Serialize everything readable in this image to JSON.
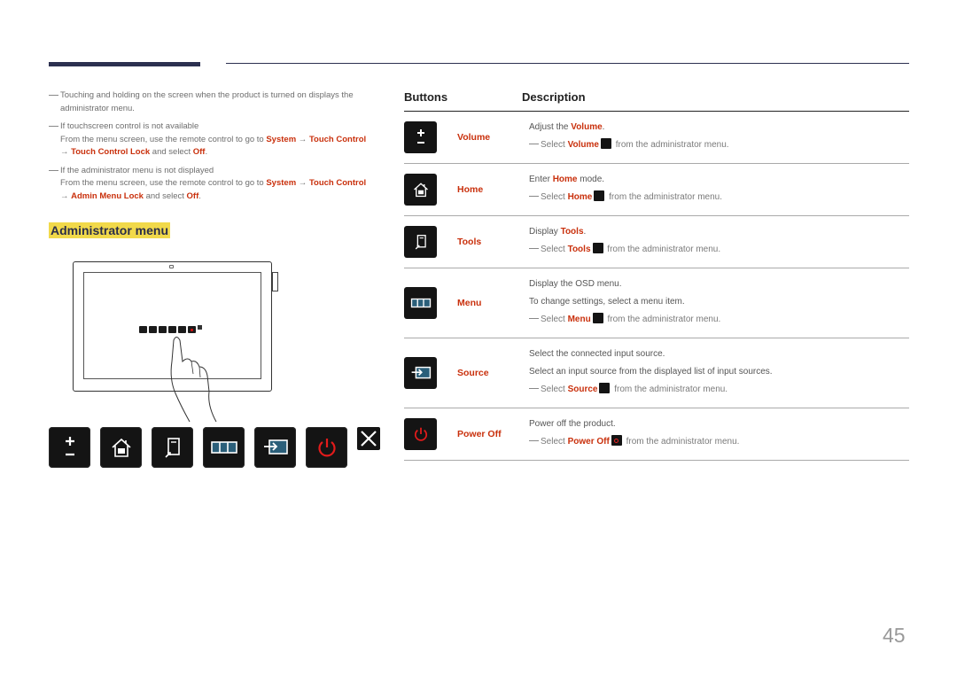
{
  "notes": [
    {
      "text": "Touching and holding on the screen when the product is turned on displays the administrator menu."
    },
    {
      "text": "If touchscreen control is not available",
      "sub": {
        "pre": "From the menu screen, use the remote control to go to ",
        "path1": "System",
        "arrow1": " → ",
        "path2": "Touch Control",
        "arrow2": " → ",
        "path3": "Touch Control Lock",
        "mid": " and select ",
        "value": "Off",
        "end": "."
      }
    },
    {
      "text": "If the administrator menu is not displayed",
      "sub": {
        "pre": "From the menu screen, use the remote control to go to ",
        "path1": "System",
        "arrow1": " → ",
        "path2": "Touch Control",
        "arrow2": " → ",
        "path3": "Admin Menu Lock",
        "mid": " and select ",
        "value": "Off",
        "end": "."
      }
    }
  ],
  "section_title": "Administrator menu",
  "illustration": {
    "menu_icons": [
      "volume-icon",
      "home-icon",
      "tools-icon",
      "menu-icon",
      "source-icon",
      "power-off-icon",
      "close-icon"
    ]
  },
  "table": {
    "headers": [
      "Buttons",
      "Description"
    ],
    "rows": [
      {
        "icon": "volume-icon",
        "name": "Volume",
        "lines": [
          {
            "pre": "Adjust the ",
            "em": "Volume",
            "post": "."
          }
        ],
        "note": {
          "pre": "Select ",
          "em": "Volume",
          "post": " from the administrator menu."
        }
      },
      {
        "icon": "home-icon",
        "name": "Home",
        "lines": [
          {
            "pre": "Enter ",
            "em": "Home",
            "post": " mode."
          }
        ],
        "note": {
          "pre": "Select ",
          "em": "Home",
          "post": " from the administrator menu."
        }
      },
      {
        "icon": "tools-icon",
        "name": "Tools",
        "lines": [
          {
            "pre": "Display ",
            "em": "Tools",
            "post": "."
          }
        ],
        "note": {
          "pre": "Select ",
          "em": "Tools",
          "post": " from the administrator menu."
        }
      },
      {
        "icon": "menu-icon",
        "name": "Menu",
        "lines": [
          {
            "pre": "Display the OSD menu.",
            "em": "",
            "post": ""
          },
          {
            "pre": "To change settings, select a menu item.",
            "em": "",
            "post": ""
          }
        ],
        "note": {
          "pre": "Select ",
          "em": "Menu",
          "post": " from the administrator menu."
        }
      },
      {
        "icon": "source-icon",
        "name": "Source",
        "lines": [
          {
            "pre": "Select the connected input source.",
            "em": "",
            "post": ""
          },
          {
            "pre": "Select an input source from the displayed list of input sources.",
            "em": "",
            "post": ""
          }
        ],
        "note": {
          "pre": "Select ",
          "em": "Source",
          "post": " from the administrator menu."
        }
      },
      {
        "icon": "power-off-icon",
        "name": "Power Off",
        "lines": [
          {
            "pre": "Power off the product.",
            "em": "",
            "post": ""
          }
        ],
        "note": {
          "pre": "Select ",
          "em": "Power Off",
          "post": " from the administrator menu."
        }
      }
    ]
  },
  "colors": {
    "accent": "#c9300c",
    "highlight": "#f1d94a",
    "header_bar": "#2c3050"
  },
  "page_number": "45"
}
